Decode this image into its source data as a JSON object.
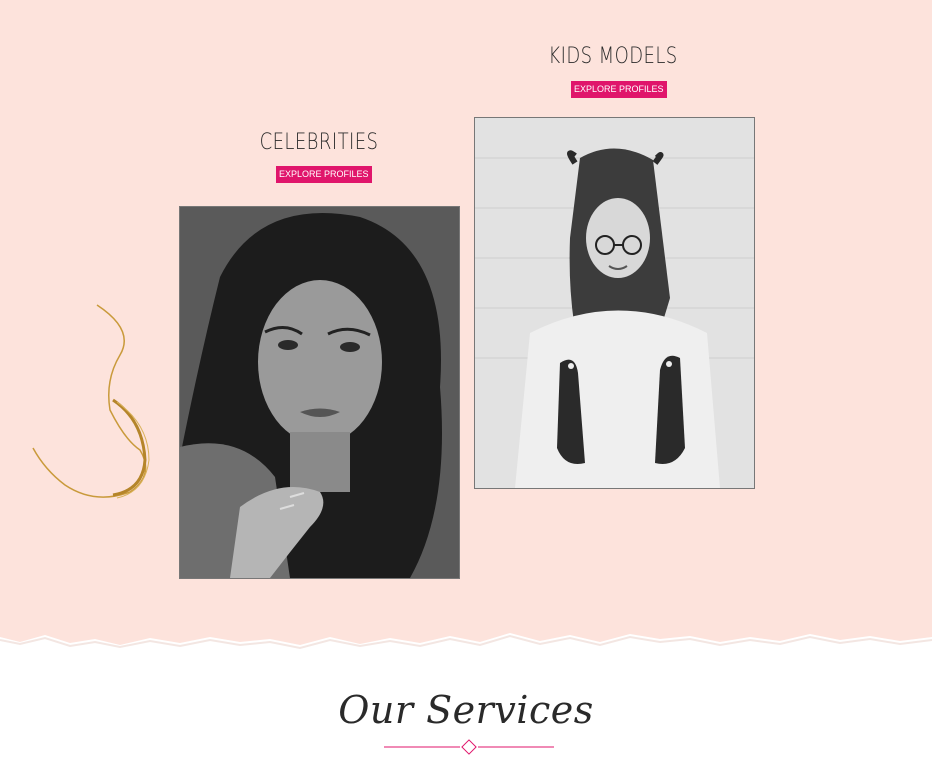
{
  "categories": [
    {
      "title": "KIDS MODELS",
      "button_label": "EXPLORE PROFILES",
      "photo": "child-portrait"
    },
    {
      "title": "CELEBRITIES",
      "button_label": "EXPLORE PROFILES",
      "photo": "woman-portrait"
    }
  ],
  "services": {
    "title": "Our Services"
  },
  "colors": {
    "background_pink": "#fde3dc",
    "accent": "#e0156b",
    "gold": "#c99a3b"
  },
  "icons": [
    "gold-curl-ornament",
    "diamond-divider-icon"
  ]
}
